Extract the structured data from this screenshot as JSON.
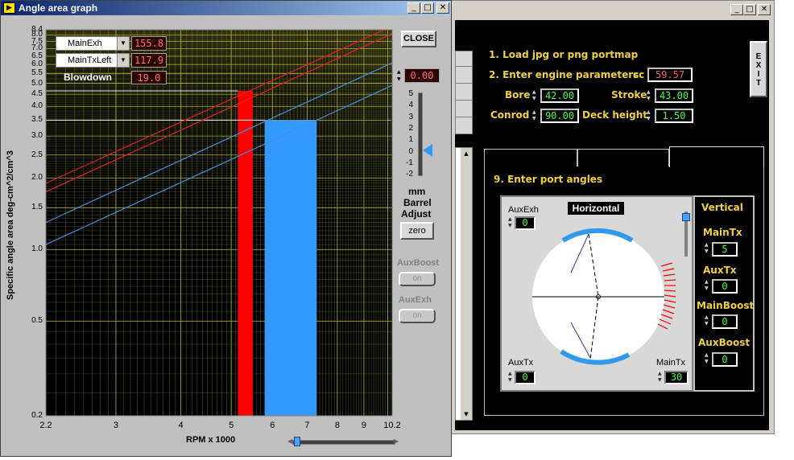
{
  "front_window": {
    "title": "Angle area graph",
    "close_button": "CLOSE",
    "dropdown1": {
      "value": "MainExh",
      "number": "155.8"
    },
    "dropdown2": {
      "value": "MainTxLeft",
      "number": "117.9"
    },
    "blowdown": {
      "label": "Blowdown",
      "value": "19.0"
    },
    "barrel": {
      "value": "0.00",
      "scale": [
        "5",
        "4",
        "3",
        "2",
        "1",
        "0",
        "-1",
        "-2"
      ],
      "unit": "mm",
      "label1": "Barrel",
      "label2": "Adjust",
      "zero_button": "zero"
    },
    "auxboost": {
      "label": "AuxBoost",
      "button": "on"
    },
    "auxexh": {
      "label": "AuxExh",
      "button": "on"
    }
  },
  "chart_data": {
    "type": "line",
    "xlabel": "RPM x 1000",
    "ylabel": "Specific angle area  deg-cm^2/cm^3",
    "xlim": [
      2.2,
      10.2
    ],
    "ylim": [
      0.2,
      8.4
    ],
    "x_scale": "log",
    "y_scale": "log",
    "x_ticks": [
      "2.2",
      "3",
      "4",
      "5",
      "6",
      "7",
      "8",
      "9",
      "10.2"
    ],
    "y_ticks": [
      "8.4",
      "8.0",
      "7.5",
      "7.0",
      "6.5",
      "6.0",
      "5.5",
      "5.0",
      "4.5",
      "4.0",
      "3.5",
      "3.0",
      "2.5",
      "2.0",
      "1.5",
      "1.0",
      "0.5",
      "0.2"
    ],
    "grid": true,
    "series": [
      {
        "color": "#e02020",
        "x": [
          2.2,
          10.2
        ],
        "y": [
          1.9,
          8.7
        ]
      },
      {
        "color": "#e02020",
        "x": [
          2.2,
          10.2
        ],
        "y": [
          1.75,
          8.1
        ]
      },
      {
        "color": "#4090e0",
        "x": [
          2.2,
          10.2
        ],
        "y": [
          1.3,
          6.1
        ]
      },
      {
        "color": "#4090e0",
        "x": [
          2.2,
          10.2
        ],
        "y": [
          1.05,
          4.9
        ]
      }
    ],
    "bars": [
      {
        "color": "#ff0000",
        "x0": 5.15,
        "x1": 5.5,
        "y": 4.65
      },
      {
        "color": "#3399ff",
        "x0": 5.8,
        "x1": 7.3,
        "y": 3.5
      }
    ],
    "hlines": [
      {
        "y": 4.65,
        "x_end": 5.15
      },
      {
        "y": 3.5,
        "x_end": 5.8
      }
    ]
  },
  "back_window": {
    "exit": "EXIT",
    "step1": "1. Load jpg or png portmap",
    "step2": "2. Enter engine parameters",
    "cc": {
      "label": "cc",
      "value": "59.57"
    },
    "bore": {
      "label": "Bore",
      "value": "42.00"
    },
    "stroke": {
      "label": "Stroke",
      "value": "43.00"
    },
    "conrod": {
      "label": "Conrod",
      "value": "90.00"
    },
    "deck": {
      "label": "Deck height",
      "value": "1.50"
    },
    "step9": "9. Enter port angles",
    "horizontal": "Horizontal",
    "vertical": "Vertical",
    "auxexh": {
      "label": "AuxExh",
      "value": "0"
    },
    "auxtx": {
      "label": "AuxTx",
      "value": "0"
    },
    "maintx_h": {
      "label": "MainTx",
      "value": "30"
    },
    "v_maintx": {
      "label": "MainTx",
      "value": "5"
    },
    "v_auxtx": {
      "label": "AuxTx",
      "value": "0"
    },
    "v_mainboost": {
      "label": "MainBoost",
      "value": "0"
    },
    "v_auxboost": {
      "label": "AuxBoost",
      "value": "0"
    }
  },
  "colors": {
    "title_bar": "#0a246a",
    "plot_bg": "#000000",
    "grid": "#b8b840",
    "label_yellow": "#f0d040",
    "value_green": "#40ff40",
    "value_red": "#ff7070"
  }
}
